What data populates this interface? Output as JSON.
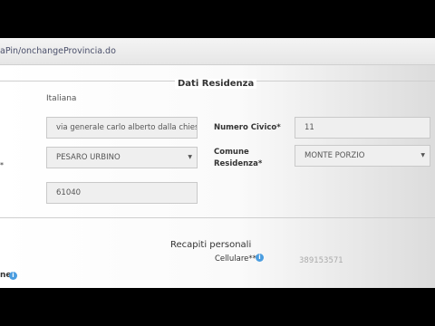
{
  "browser": {
    "url": "aPin/onchangeProvincia.do"
  },
  "residence": {
    "section_title": "Dati Residenza",
    "nationality": "Italiana",
    "address_value": "via generale carlo alberto dalla chiesa",
    "street_number_label": "Numero Civico*",
    "street_number_value": "11",
    "province_value": "PESARO URBINO",
    "municipality_label": "Comune Residenza*",
    "municipality_value": "MONTE PORZIO",
    "postal_code_value": "61040",
    "required_marker": "*"
  },
  "contacts": {
    "section_title": "Recapiti personali",
    "mobile_label": "Cellulare**",
    "mobile_value": "389153571",
    "cut_label": "ne"
  },
  "colors": {
    "info_icon": "#4a9de0"
  }
}
